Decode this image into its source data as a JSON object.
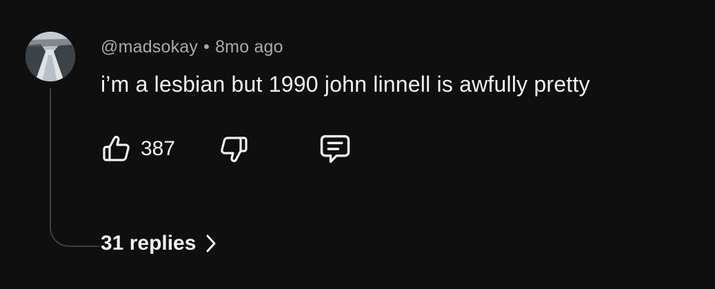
{
  "comment": {
    "author": "@madsokay",
    "separator": "•",
    "timestamp": "8mo ago",
    "text": "i’m a lesbian but 1990 john linnell is awfully pretty",
    "like_count": "387",
    "replies_label": "31 replies"
  },
  "icons": {
    "like": "thumbs-up-icon",
    "dislike": "thumbs-down-icon",
    "reply": "comment-icon",
    "chevron": "chevron-right-icon"
  },
  "colors": {
    "background": "#0f0f0f",
    "primary_text": "#f1f1f1",
    "secondary_text": "#aaaaaa",
    "thread_line": "#3f3f3f"
  }
}
